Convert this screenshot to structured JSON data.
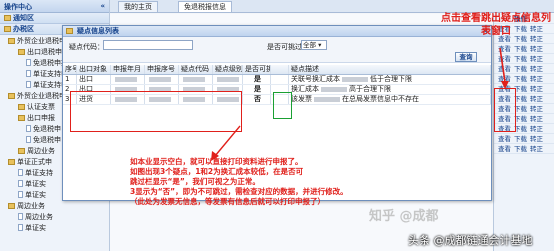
{
  "sidebar": {
    "header_title": "操作中心",
    "collapse_icon": "double-chevron-left-icon",
    "sections": [
      {
        "label": "通知区",
        "type": "section"
      },
      {
        "label": "办税区",
        "type": "section"
      }
    ],
    "items": [
      {
        "label": "外贸企业退税申",
        "level": 1,
        "icon": "folder-icon"
      },
      {
        "label": "出口退税申报",
        "level": 2,
        "icon": "folder-icon"
      },
      {
        "label": "免退税申报",
        "level": 3,
        "icon": "page-icon"
      },
      {
        "label": "单证支持申",
        "level": 3,
        "icon": "page-icon"
      },
      {
        "label": "单证支持申",
        "level": 3,
        "icon": "page-icon"
      },
      {
        "label": "外贸企业退税申",
        "level": 1,
        "icon": "folder-icon"
      },
      {
        "label": "认证支票",
        "level": 2,
        "icon": "folder-icon"
      },
      {
        "label": "出口申报",
        "level": 2,
        "icon": "folder-icon"
      },
      {
        "label": "免退税申",
        "level": 3,
        "icon": "page-icon"
      },
      {
        "label": "免退税申",
        "level": 3,
        "icon": "page-icon"
      },
      {
        "label": "周边业务",
        "level": 2,
        "icon": "folder-icon"
      },
      {
        "label": "单证正式申",
        "level": 1,
        "icon": "folder-icon"
      },
      {
        "label": "单证支持",
        "level": 2,
        "icon": "page-icon"
      },
      {
        "label": "单证实",
        "level": 2,
        "icon": "page-icon"
      },
      {
        "label": "单证实",
        "level": 2,
        "icon": "page-icon"
      },
      {
        "label": "周边业务",
        "level": 1,
        "icon": "folder-icon"
      },
      {
        "label": "周边业务",
        "level": 2,
        "icon": "page-icon"
      },
      {
        "label": "单证实",
        "level": 2,
        "icon": "page-icon"
      }
    ]
  },
  "topbar": {
    "tabs": [
      {
        "label": "我的主页"
      },
      {
        "label": "免退税报信息"
      }
    ]
  },
  "dialog": {
    "title": "疑点信息列表",
    "close_label": "×",
    "filters": {
      "code_label": "疑点代码：",
      "code_value": "",
      "skip_label": "是否可挑过",
      "skip_value": "全部",
      "query_label": "查询"
    },
    "columns": [
      "序号",
      "出口对象",
      "申报年月",
      "申报序号",
      "疑点代码",
      "疑点级别",
      "是否可挑",
      "",
      "疑点描述"
    ],
    "rows": [
      {
        "index": "1",
        "target": "出口",
        "skippable": "是",
        "desc_prefix": "关联号换汇成本",
        "desc_suffix": "低于合理下限"
      },
      {
        "index": "2",
        "target": "出口",
        "skippable": "是",
        "desc_prefix": "换汇成本",
        "desc_suffix": "高于合理下限"
      },
      {
        "index": "3",
        "target": "进货",
        "skippable": "否",
        "desc_prefix": "该发票",
        "desc_suffix": "在总局发票信息中不存在"
      }
    ]
  },
  "rightcol": {
    "header": "操作",
    "rows": [
      {
        "view": "查看",
        "b": "下载",
        "c": "转正"
      },
      {
        "view": "查看",
        "b": "下载",
        "c": "转正"
      },
      {
        "view": "查看",
        "b": "下载",
        "c": "转正"
      },
      {
        "view": "查看",
        "b": "下载",
        "c": "转正"
      },
      {
        "view": "查看",
        "b": "下载",
        "c": "转正"
      },
      {
        "view": "查看",
        "b": "下载",
        "c": "转正"
      },
      {
        "view": "查看",
        "b": "下载",
        "c": "转正"
      },
      {
        "view": "查看",
        "b": "下载",
        "c": "转正"
      },
      {
        "view": "查看",
        "b": "下载",
        "c": "转正"
      },
      {
        "view": "查看",
        "b": "下载",
        "c": "转正"
      },
      {
        "view": "查看",
        "b": "下载",
        "c": "转正"
      },
      {
        "view": "查看",
        "b": "下载",
        "c": "转正"
      },
      {
        "view": "查看",
        "b": "下载",
        "c": "转正"
      }
    ]
  },
  "annotations": {
    "note1": "点击查看跳出疑点信息列表窗口",
    "note2_lines": [
      "如本业显示空白，就可以直接打印资料进行申报了。",
      "如图出现3个疑点，1和2为换汇成本较低，在是否可",
      "跳过栏显示“是”，我们可视之为正常。",
      "3显示为“否”，即为不可跳过，需检查对应的数据，并进行修改。",
      "（此处为发票无信息，等发票有信息后就可以打印申报了）"
    ],
    "accent_red": "#e0201b",
    "accent_green": "#1aa033"
  },
  "watermark": {
    "text1": "知乎 @成都",
    "text2": "头条 @成都链通会计基地"
  }
}
